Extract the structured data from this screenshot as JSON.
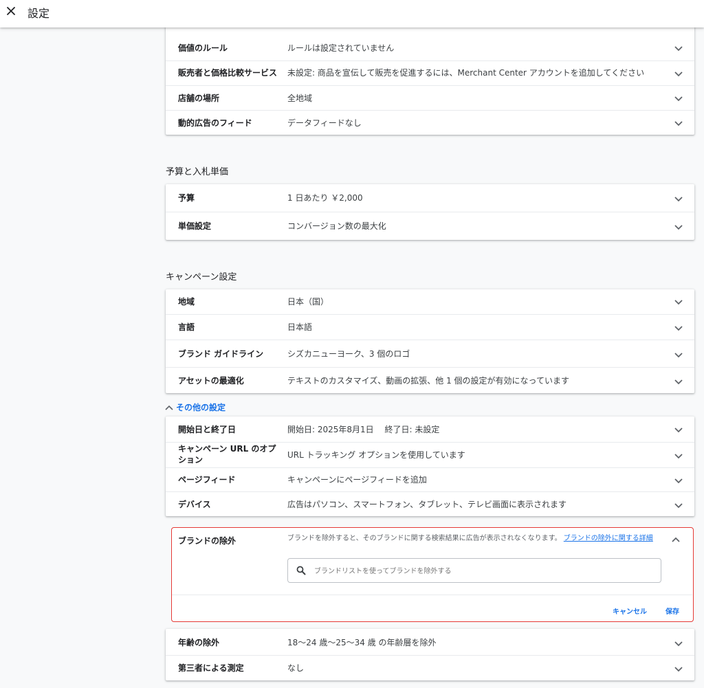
{
  "header": {
    "title": "設定"
  },
  "top_rows": [
    {
      "label": "価値のルール",
      "value": "ルールは設定されていません"
    },
    {
      "label": "販売者と価格比較サービス",
      "value": "未設定: 商品を宣伝して販売を促進するには、Merchant Center アカウントを追加してください"
    },
    {
      "label": "店舗の場所",
      "value": "全地域"
    },
    {
      "label": "動的広告のフィード",
      "value": "データフィードなし"
    }
  ],
  "budget_section": {
    "title": "予算と入札単価",
    "rows": [
      {
        "label": "予算",
        "value": "1 日あたり ￥2,000"
      },
      {
        "label": "単価設定",
        "value": "コンバージョン数の最大化"
      }
    ]
  },
  "campaign_section": {
    "title": "キャンペーン設定",
    "rows": [
      {
        "label": "地域",
        "value": "日本（国）"
      },
      {
        "label": "言語",
        "value": "日本語"
      },
      {
        "label": "ブランド ガイドライン",
        "value": "シズカニューヨーク、3 個のロゴ"
      },
      {
        "label": "アセットの最適化",
        "value": "テキストのカスタマイズ、動画の拡張、他 1 個の設定が有効になっています"
      }
    ]
  },
  "more_settings": {
    "toggle_label": "その他の設定",
    "rows": [
      {
        "label": "開始日と終了日",
        "value": "開始日: 2025年8月1日　 終了日: 未設定"
      },
      {
        "label": "キャンペーン URL のオプション",
        "value": "URL トラッキング オプションを使用しています"
      },
      {
        "label": "ページフィード",
        "value": "キャンペーンにページフィードを追加"
      },
      {
        "label": "デバイス",
        "value": "広告はパソコン、スマートフォン、タブレット、テレビ画面に表示されます"
      }
    ]
  },
  "brand_exclusion": {
    "label": "ブランドの除外",
    "description": "ブランドを除外すると、そのブランドに関する検索結果に広告が表示されなくなります。",
    "link": "ブランドの除外に関する詳細",
    "search_placeholder": "ブランドリストを使ってブランドを除外する",
    "cancel": "キャンセル",
    "save": "保存"
  },
  "bottom_rows": [
    {
      "label": "年齢の除外",
      "value": "18〜24 歳〜25〜34 歳 の年齢層を除外"
    },
    {
      "label": "第三者による測定",
      "value": "なし"
    }
  ],
  "colors": {
    "accent": "#1a73e8",
    "highlight_border": "#e53935"
  },
  "icons": {
    "close": "close-icon",
    "chevron": "chevron-down-icon",
    "search": "search-icon"
  }
}
